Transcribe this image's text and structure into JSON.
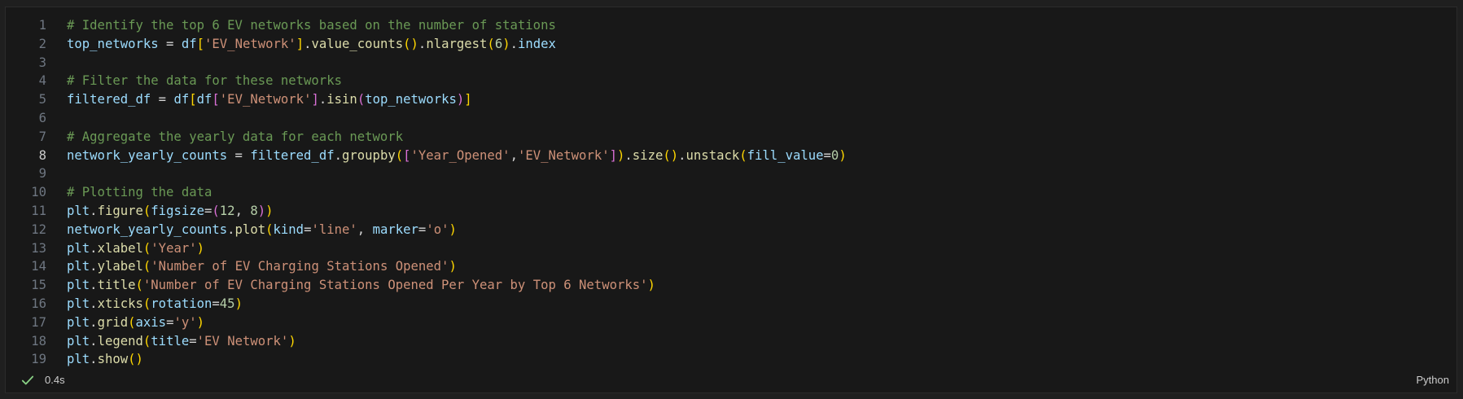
{
  "editor": {
    "active_line": 8,
    "lines": [
      {
        "n": "1",
        "tokens": [
          {
            "t": "# Identify the top 6 EV networks based on the number of stations",
            "c": "comment"
          }
        ]
      },
      {
        "n": "2",
        "tokens": [
          {
            "t": "top_networks",
            "c": "var"
          },
          {
            "t": " = ",
            "c": "op"
          },
          {
            "t": "df",
            "c": "var"
          },
          {
            "t": "[",
            "c": "b1"
          },
          {
            "t": "'EV_Network'",
            "c": "str"
          },
          {
            "t": "]",
            "c": "b1"
          },
          {
            "t": ".",
            "c": "op"
          },
          {
            "t": "value_counts",
            "c": "fn"
          },
          {
            "t": "()",
            "c": "b1"
          },
          {
            "t": ".",
            "c": "op"
          },
          {
            "t": "nlargest",
            "c": "fn"
          },
          {
            "t": "(",
            "c": "b1"
          },
          {
            "t": "6",
            "c": "num"
          },
          {
            "t": ")",
            "c": "b1"
          },
          {
            "t": ".",
            "c": "op"
          },
          {
            "t": "index",
            "c": "var"
          }
        ]
      },
      {
        "n": "3",
        "tokens": []
      },
      {
        "n": "4",
        "tokens": [
          {
            "t": "# Filter the data for these networks",
            "c": "comment"
          }
        ]
      },
      {
        "n": "5",
        "tokens": [
          {
            "t": "filtered_df",
            "c": "var"
          },
          {
            "t": " = ",
            "c": "op"
          },
          {
            "t": "df",
            "c": "var"
          },
          {
            "t": "[",
            "c": "b1"
          },
          {
            "t": "df",
            "c": "var"
          },
          {
            "t": "[",
            "c": "b2"
          },
          {
            "t": "'EV_Network'",
            "c": "str"
          },
          {
            "t": "]",
            "c": "b2"
          },
          {
            "t": ".",
            "c": "op"
          },
          {
            "t": "isin",
            "c": "fn"
          },
          {
            "t": "(",
            "c": "b2"
          },
          {
            "t": "top_networks",
            "c": "var"
          },
          {
            "t": ")",
            "c": "b2"
          },
          {
            "t": "]",
            "c": "b1"
          }
        ]
      },
      {
        "n": "6",
        "tokens": []
      },
      {
        "n": "7",
        "tokens": [
          {
            "t": "# Aggregate the yearly data for each network",
            "c": "comment"
          }
        ]
      },
      {
        "n": "8",
        "tokens": [
          {
            "t": "network_yearly_counts",
            "c": "var"
          },
          {
            "t": " = ",
            "c": "op"
          },
          {
            "t": "filtered_df",
            "c": "var"
          },
          {
            "t": ".",
            "c": "op"
          },
          {
            "t": "groupby",
            "c": "fn"
          },
          {
            "t": "(",
            "c": "b1"
          },
          {
            "t": "[",
            "c": "b2"
          },
          {
            "t": "'Year_Opened'",
            "c": "str"
          },
          {
            "t": ",",
            "c": "op"
          },
          {
            "t": "'EV_Network'",
            "c": "str"
          },
          {
            "t": "]",
            "c": "b2"
          },
          {
            "t": ")",
            "c": "b1"
          },
          {
            "t": ".",
            "c": "op"
          },
          {
            "t": "size",
            "c": "fn"
          },
          {
            "t": "()",
            "c": "b1"
          },
          {
            "t": ".",
            "c": "op"
          },
          {
            "t": "unstack",
            "c": "fn"
          },
          {
            "t": "(",
            "c": "b1"
          },
          {
            "t": "fill_value",
            "c": "var"
          },
          {
            "t": "=",
            "c": "op"
          },
          {
            "t": "0",
            "c": "num"
          },
          {
            "t": ")",
            "c": "b1"
          }
        ]
      },
      {
        "n": "9",
        "tokens": []
      },
      {
        "n": "10",
        "tokens": [
          {
            "t": "# Plotting the data",
            "c": "comment"
          }
        ]
      },
      {
        "n": "11",
        "tokens": [
          {
            "t": "plt",
            "c": "var"
          },
          {
            "t": ".",
            "c": "op"
          },
          {
            "t": "figure",
            "c": "fn"
          },
          {
            "t": "(",
            "c": "b1"
          },
          {
            "t": "figsize",
            "c": "var"
          },
          {
            "t": "=",
            "c": "op"
          },
          {
            "t": "(",
            "c": "b2"
          },
          {
            "t": "12",
            "c": "num"
          },
          {
            "t": ", ",
            "c": "op"
          },
          {
            "t": "8",
            "c": "num"
          },
          {
            "t": ")",
            "c": "b2"
          },
          {
            "t": ")",
            "c": "b1"
          }
        ]
      },
      {
        "n": "12",
        "tokens": [
          {
            "t": "network_yearly_counts",
            "c": "var"
          },
          {
            "t": ".",
            "c": "op"
          },
          {
            "t": "plot",
            "c": "fn"
          },
          {
            "t": "(",
            "c": "b1"
          },
          {
            "t": "kind",
            "c": "var"
          },
          {
            "t": "=",
            "c": "op"
          },
          {
            "t": "'line'",
            "c": "str"
          },
          {
            "t": ", ",
            "c": "op"
          },
          {
            "t": "marker",
            "c": "var"
          },
          {
            "t": "=",
            "c": "op"
          },
          {
            "t": "'o'",
            "c": "str"
          },
          {
            "t": ")",
            "c": "b1"
          }
        ]
      },
      {
        "n": "13",
        "tokens": [
          {
            "t": "plt",
            "c": "var"
          },
          {
            "t": ".",
            "c": "op"
          },
          {
            "t": "xlabel",
            "c": "fn"
          },
          {
            "t": "(",
            "c": "b1"
          },
          {
            "t": "'Year'",
            "c": "str"
          },
          {
            "t": ")",
            "c": "b1"
          }
        ]
      },
      {
        "n": "14",
        "tokens": [
          {
            "t": "plt",
            "c": "var"
          },
          {
            "t": ".",
            "c": "op"
          },
          {
            "t": "ylabel",
            "c": "fn"
          },
          {
            "t": "(",
            "c": "b1"
          },
          {
            "t": "'Number of EV Charging Stations Opened'",
            "c": "str"
          },
          {
            "t": ")",
            "c": "b1"
          }
        ]
      },
      {
        "n": "15",
        "tokens": [
          {
            "t": "plt",
            "c": "var"
          },
          {
            "t": ".",
            "c": "op"
          },
          {
            "t": "title",
            "c": "fn"
          },
          {
            "t": "(",
            "c": "b1"
          },
          {
            "t": "'Number of EV Charging Stations Opened Per Year by Top 6 Networks'",
            "c": "str"
          },
          {
            "t": ")",
            "c": "b1"
          }
        ]
      },
      {
        "n": "16",
        "tokens": [
          {
            "t": "plt",
            "c": "var"
          },
          {
            "t": ".",
            "c": "op"
          },
          {
            "t": "xticks",
            "c": "fn"
          },
          {
            "t": "(",
            "c": "b1"
          },
          {
            "t": "rotation",
            "c": "var"
          },
          {
            "t": "=",
            "c": "op"
          },
          {
            "t": "45",
            "c": "num"
          },
          {
            "t": ")",
            "c": "b1"
          }
        ]
      },
      {
        "n": "17",
        "tokens": [
          {
            "t": "plt",
            "c": "var"
          },
          {
            "t": ".",
            "c": "op"
          },
          {
            "t": "grid",
            "c": "fn"
          },
          {
            "t": "(",
            "c": "b1"
          },
          {
            "t": "axis",
            "c": "var"
          },
          {
            "t": "=",
            "c": "op"
          },
          {
            "t": "'y'",
            "c": "str"
          },
          {
            "t": ")",
            "c": "b1"
          }
        ]
      },
      {
        "n": "18",
        "tokens": [
          {
            "t": "plt",
            "c": "var"
          },
          {
            "t": ".",
            "c": "op"
          },
          {
            "t": "legend",
            "c": "fn"
          },
          {
            "t": "(",
            "c": "b1"
          },
          {
            "t": "title",
            "c": "var"
          },
          {
            "t": "=",
            "c": "op"
          },
          {
            "t": "'EV Network'",
            "c": "str"
          },
          {
            "t": ")",
            "c": "b1"
          }
        ]
      },
      {
        "n": "19",
        "tokens": [
          {
            "t": "plt",
            "c": "var"
          },
          {
            "t": ".",
            "c": "op"
          },
          {
            "t": "show",
            "c": "fn"
          },
          {
            "t": "()",
            "c": "b1"
          }
        ]
      }
    ]
  },
  "status": {
    "check_icon": "check-icon",
    "check_color": "#89d185",
    "exec_time": "0.4s",
    "language": "Python"
  }
}
